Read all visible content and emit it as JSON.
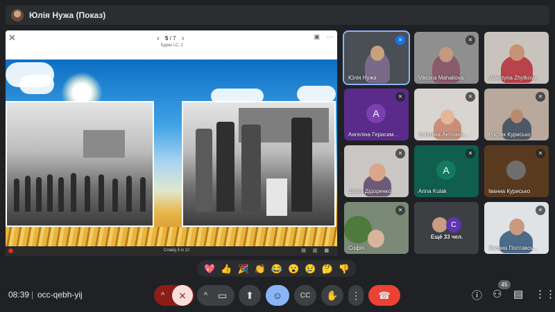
{
  "presenter": {
    "title": "Юлія Нужа (Показ)"
  },
  "presentation": {
    "page_current": "5",
    "page_total": "7",
    "page_separator": "/",
    "subtitle": "Буряк І.С. 2",
    "bottom_label": "Слайд 5 із 12",
    "slide_colors": {
      "sky": "#3fa2e6",
      "wheat": "#e9b43c"
    }
  },
  "participants": [
    {
      "name": "Юлія Нужа",
      "status": "speaking",
      "type": "video",
      "active": true
    },
    {
      "name": "Viktoria Mahaliova",
      "status": "muted",
      "type": "video"
    },
    {
      "name": "Valentyna Zhytkova",
      "status": "none",
      "type": "video"
    },
    {
      "name": "Ангеліна Герасим...",
      "status": "muted",
      "type": "avatar",
      "letter": "A",
      "color": "#6a1b9a",
      "bg": "#5b2b8c"
    },
    {
      "name": "Ангеліна Антонен...",
      "status": "muted",
      "type": "video"
    },
    {
      "name": "Ростик Курисько",
      "status": "muted",
      "type": "video"
    },
    {
      "name": "Злата Дідоренко",
      "status": "muted",
      "type": "video"
    },
    {
      "name": "Arina Kulak",
      "status": "muted",
      "type": "avatar",
      "letter": "A",
      "color": "#0b8043",
      "bg": "#0f5e4e"
    },
    {
      "name": "Іванна Курисько",
      "status": "muted",
      "type": "video"
    },
    {
      "name": "Софія",
      "status": "muted",
      "type": "video"
    },
    {
      "name": "Ещё 33 чел.",
      "status": "none",
      "type": "more",
      "letter": "C"
    },
    {
      "name": "Оксана Полтавсь...",
      "status": "muted",
      "type": "video"
    }
  ],
  "reactions": [
    "💖",
    "👍",
    "🎉",
    "👏",
    "😂",
    "😮",
    "😢",
    "🤔",
    "👎"
  ],
  "footer": {
    "time": "08:39",
    "separator": "|",
    "meeting_code": "occ-qebh-yij",
    "participant_count": "45"
  },
  "icons": {
    "close": "✕",
    "prev": "‹",
    "next": "›",
    "mic_off": "🎙",
    "camera": "📷",
    "present": "⬆",
    "emoji": "☺",
    "captions": "CC",
    "hand": "✋",
    "more": "⋮",
    "end_call": "☎",
    "info": "ⓘ",
    "people": "👥",
    "chat": "💬",
    "activities": "⋯"
  },
  "colors": {
    "accent": "#8ab4f8",
    "end_call": "#ea4335",
    "mic_off_bg": "#f9dedc"
  }
}
